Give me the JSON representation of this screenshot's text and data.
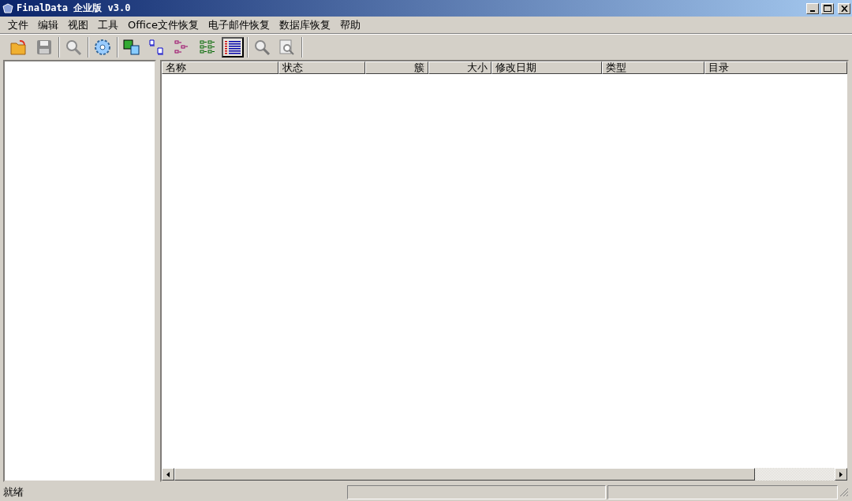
{
  "window": {
    "title": "FinalData 企业版 v3.0"
  },
  "menu": [
    "文件",
    "编辑",
    "视图",
    "工具",
    "Office文件恢复",
    "电子邮件恢复",
    "数据库恢复",
    "帮助"
  ],
  "toolbar": [
    [
      {
        "kind": "open",
        "disabled": false,
        "pressed": false
      },
      {
        "kind": "save",
        "disabled": true,
        "pressed": false
      }
    ],
    [
      {
        "kind": "search",
        "disabled": true,
        "pressed": false
      }
    ],
    [
      {
        "kind": "gear",
        "disabled": false,
        "pressed": false
      }
    ],
    [
      {
        "kind": "images",
        "disabled": false,
        "pressed": false
      },
      {
        "kind": "files",
        "disabled": false,
        "pressed": false
      },
      {
        "kind": "tree",
        "disabled": false,
        "pressed": false
      },
      {
        "kind": "grid",
        "disabled": false,
        "pressed": false
      },
      {
        "kind": "details",
        "disabled": false,
        "pressed": true
      }
    ],
    [
      {
        "kind": "zoom",
        "disabled": true,
        "pressed": false
      },
      {
        "kind": "find",
        "disabled": true,
        "pressed": false
      }
    ]
  ],
  "table": {
    "columns": [
      {
        "label": "名称",
        "kind": "text"
      },
      {
        "label": "状态",
        "kind": "text"
      },
      {
        "label": "簇",
        "kind": "number"
      },
      {
        "label": "大小",
        "kind": "number"
      },
      {
        "label": "修改日期",
        "kind": "text"
      },
      {
        "label": "类型",
        "kind": "text"
      },
      {
        "label": "目录",
        "kind": "text"
      }
    ]
  },
  "status_bar": {
    "message": "就绪"
  }
}
